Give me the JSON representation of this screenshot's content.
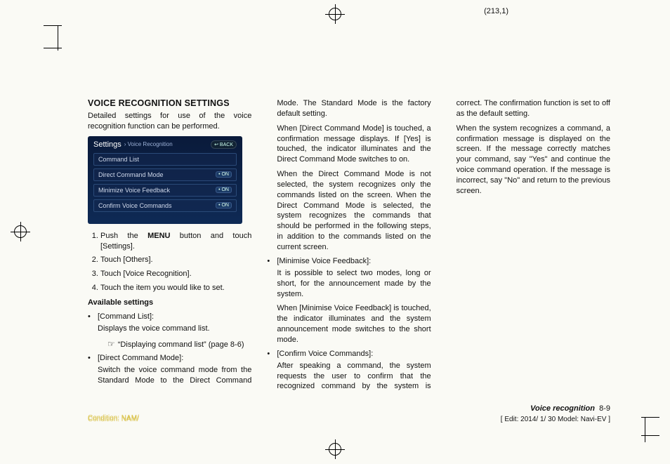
{
  "page_coord": "(213,1)",
  "heading": "VOICE RECOGNITION SETTINGS",
  "intro": "Detailed settings for use of the voice recognition function can be performed.",
  "screenshot": {
    "title": "Settings",
    "crumb": "Voice Recognition",
    "back": "↩ BACK",
    "rows": [
      {
        "label": "Command List",
        "toggle": null
      },
      {
        "label": "Direct Command Mode",
        "toggle": "• ON"
      },
      {
        "label": "Minimize Voice Feedback",
        "toggle": "• ON"
      },
      {
        "label": "Confirm Voice Commands",
        "toggle": "• ON"
      }
    ]
  },
  "steps_prefix": "Push the ",
  "steps_menu": "MENU",
  "steps_suffix": " button and touch [Settings].",
  "steps": [
    "Touch [Others].",
    "Touch [Voice Recognition].",
    "Touch the item you would like to set."
  ],
  "available_heading": "Available settings",
  "b1_label": "[Command List]:",
  "b1_text": "Displays the voice command list.",
  "b1_xref": "“Displaying command list” (page 8-6)",
  "b2_label": "[Direct Command Mode]:",
  "b2_text": "Switch the voice command mode from the Standard Mode to the Direct Command Mode. The Standard Mode is the factory default setting.",
  "b2_p1": "When [Direct Command Mode] is touched, a confirmation message displays. If [Yes] is touched, the indicator illuminates and the Direct Command Mode switches to on.",
  "b2_p2": "When the Direct Command Mode is not selected, the system recognizes only the commands listed on the screen. When the Direct Command Mode is selected, the system recognizes the commands that should be performed in the following steps, in addition to the commands listed on the current screen.",
  "b3_label": "[Minimise Voice Feedback]:",
  "b3_text": "It is possible to select two modes, long or short, for the announcement made by the system.",
  "b3_p1": "When [Minimise Voice Feedback] is touched, the indicator illuminates and the system announcement mode switches to the short mode.",
  "b4_label": "[Confirm Voice Commands]:",
  "b4_text": "After speaking a command, the system requests the user to confirm that the recognized command by the system is correct. The confirmation function is set to off as the default setting.",
  "b4_p1": "When the system recognizes a command, a confirmation message is displayed on the screen. If the message correctly matches your command, say \"Yes\" and continue the voice command operation. If the message is incorrect, say \"No\" and return to the previous screen.",
  "footer": {
    "condition": "Condition: NAM/",
    "edit": "[ Edit: 2014/ 1/ 30   Model:  Navi-EV ]",
    "section_label": "Voice recognition",
    "section_page": "8-9"
  }
}
